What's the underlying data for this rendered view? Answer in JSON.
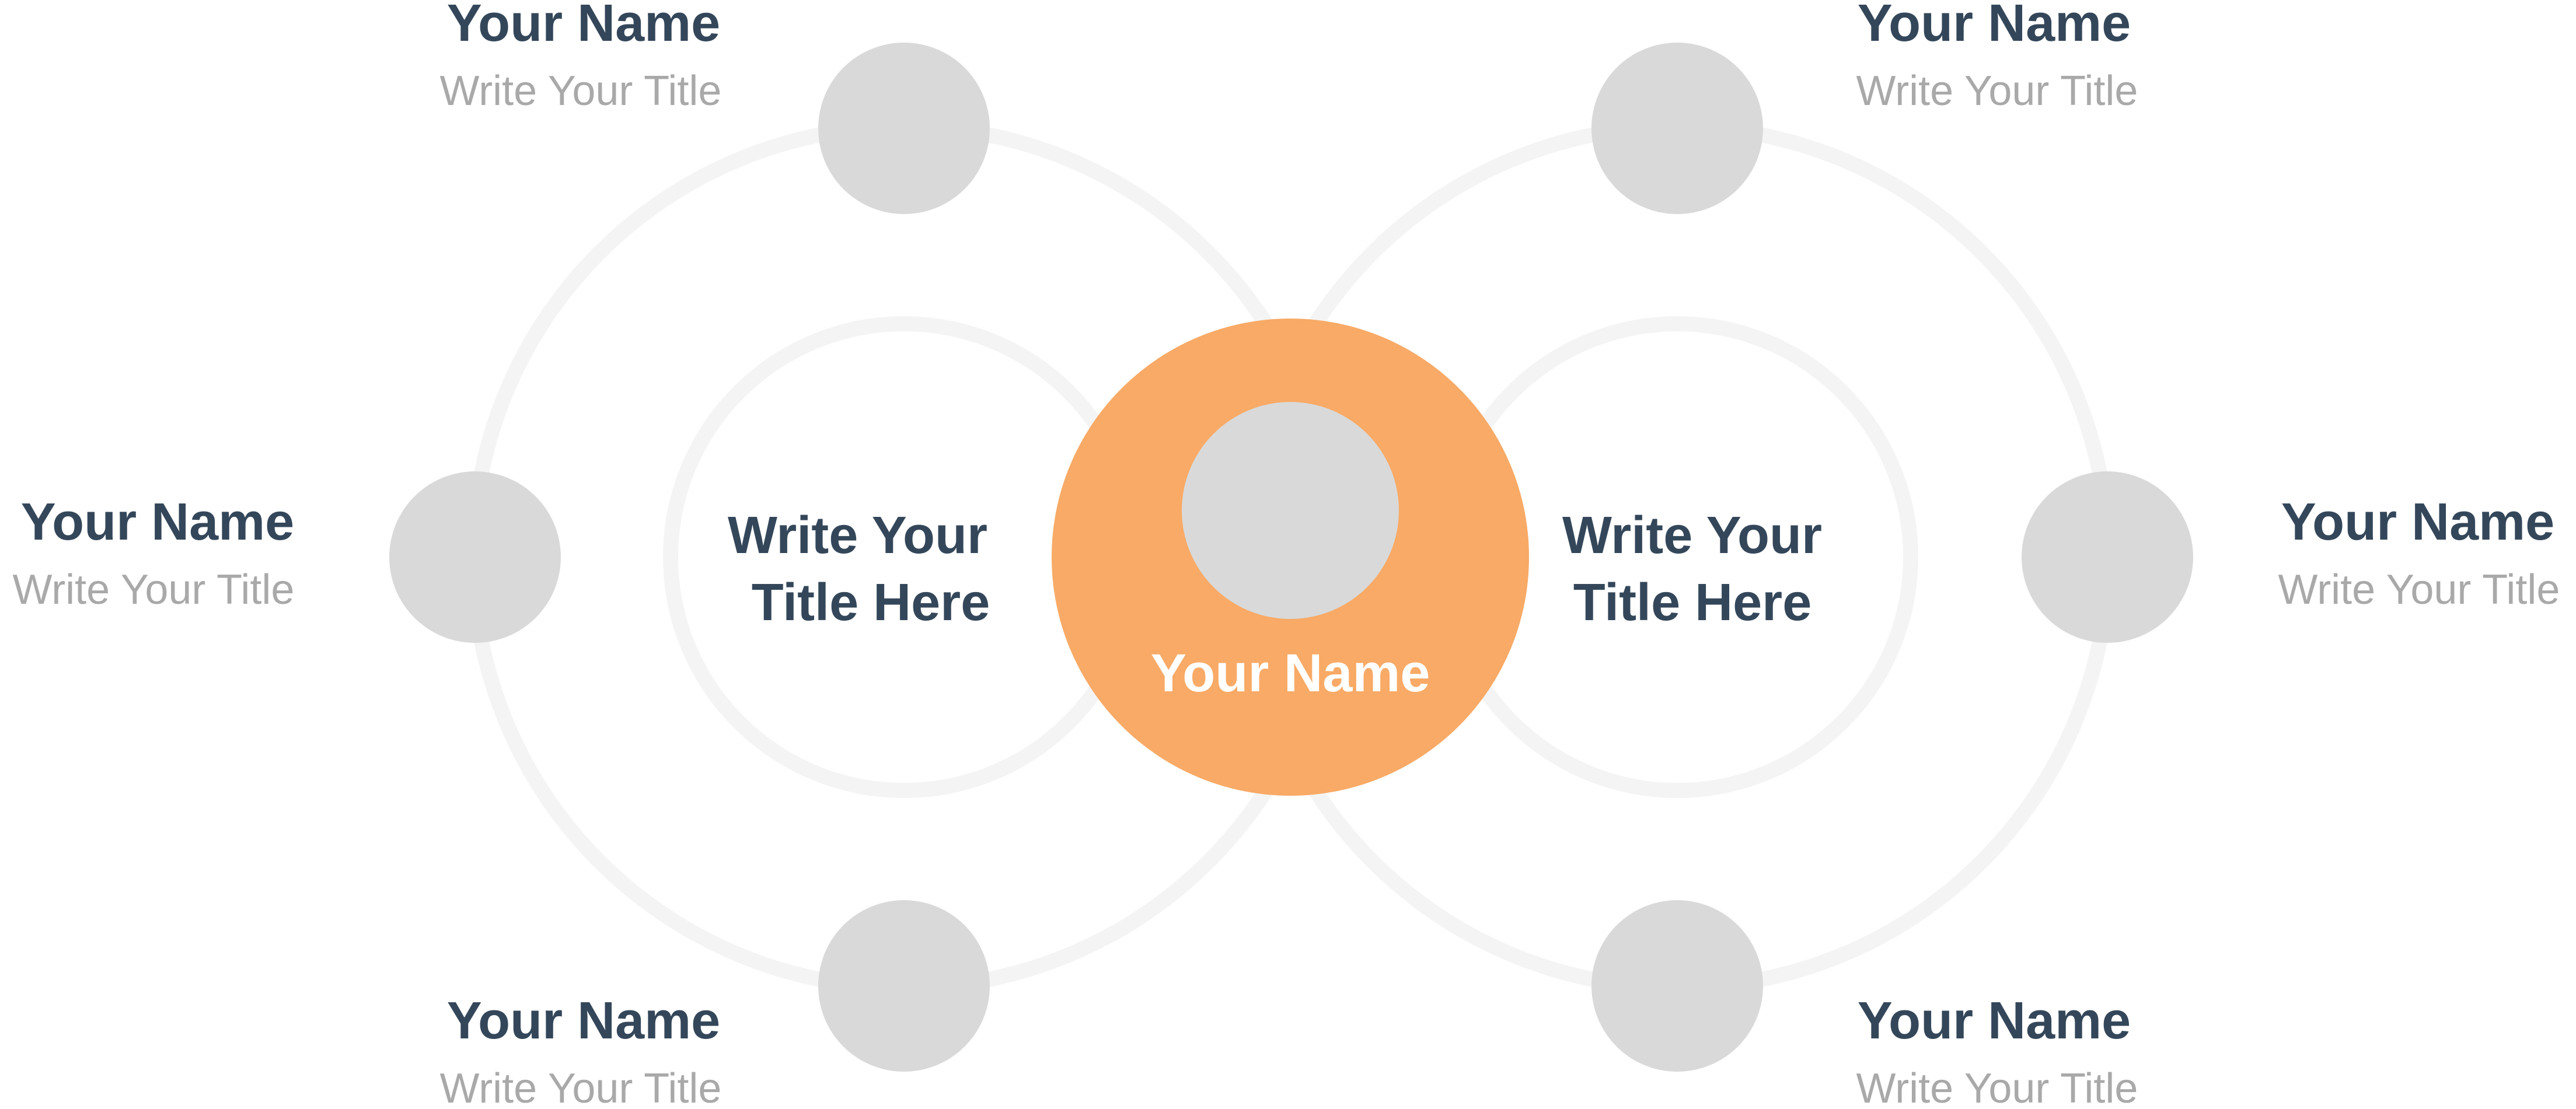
{
  "hub": {
    "name": "Your Name",
    "color": "#f8aa66"
  },
  "groups": [
    {
      "title_line1": "Write Your",
      "title_line2": "Title Here"
    },
    {
      "title_line1": "Write Your",
      "title_line2": "Title Here"
    }
  ],
  "members": [
    {
      "name": "Your Name",
      "title": "Write Your Title"
    },
    {
      "name": "Your Name",
      "title": "Write Your Title"
    },
    {
      "name": "Your Name",
      "title": "Write Your Title"
    },
    {
      "name": "Your Name",
      "title": "Write Your Title"
    },
    {
      "name": "Your Name",
      "title": "Write Your Title"
    },
    {
      "name": "Your Name",
      "title": "Write Your Title"
    }
  ],
  "colors": {
    "text_dark": "#34475a",
    "text_light": "#a9a9a9",
    "node_gray": "#d9d9d9",
    "ring_gray": "#f4f4f4"
  }
}
